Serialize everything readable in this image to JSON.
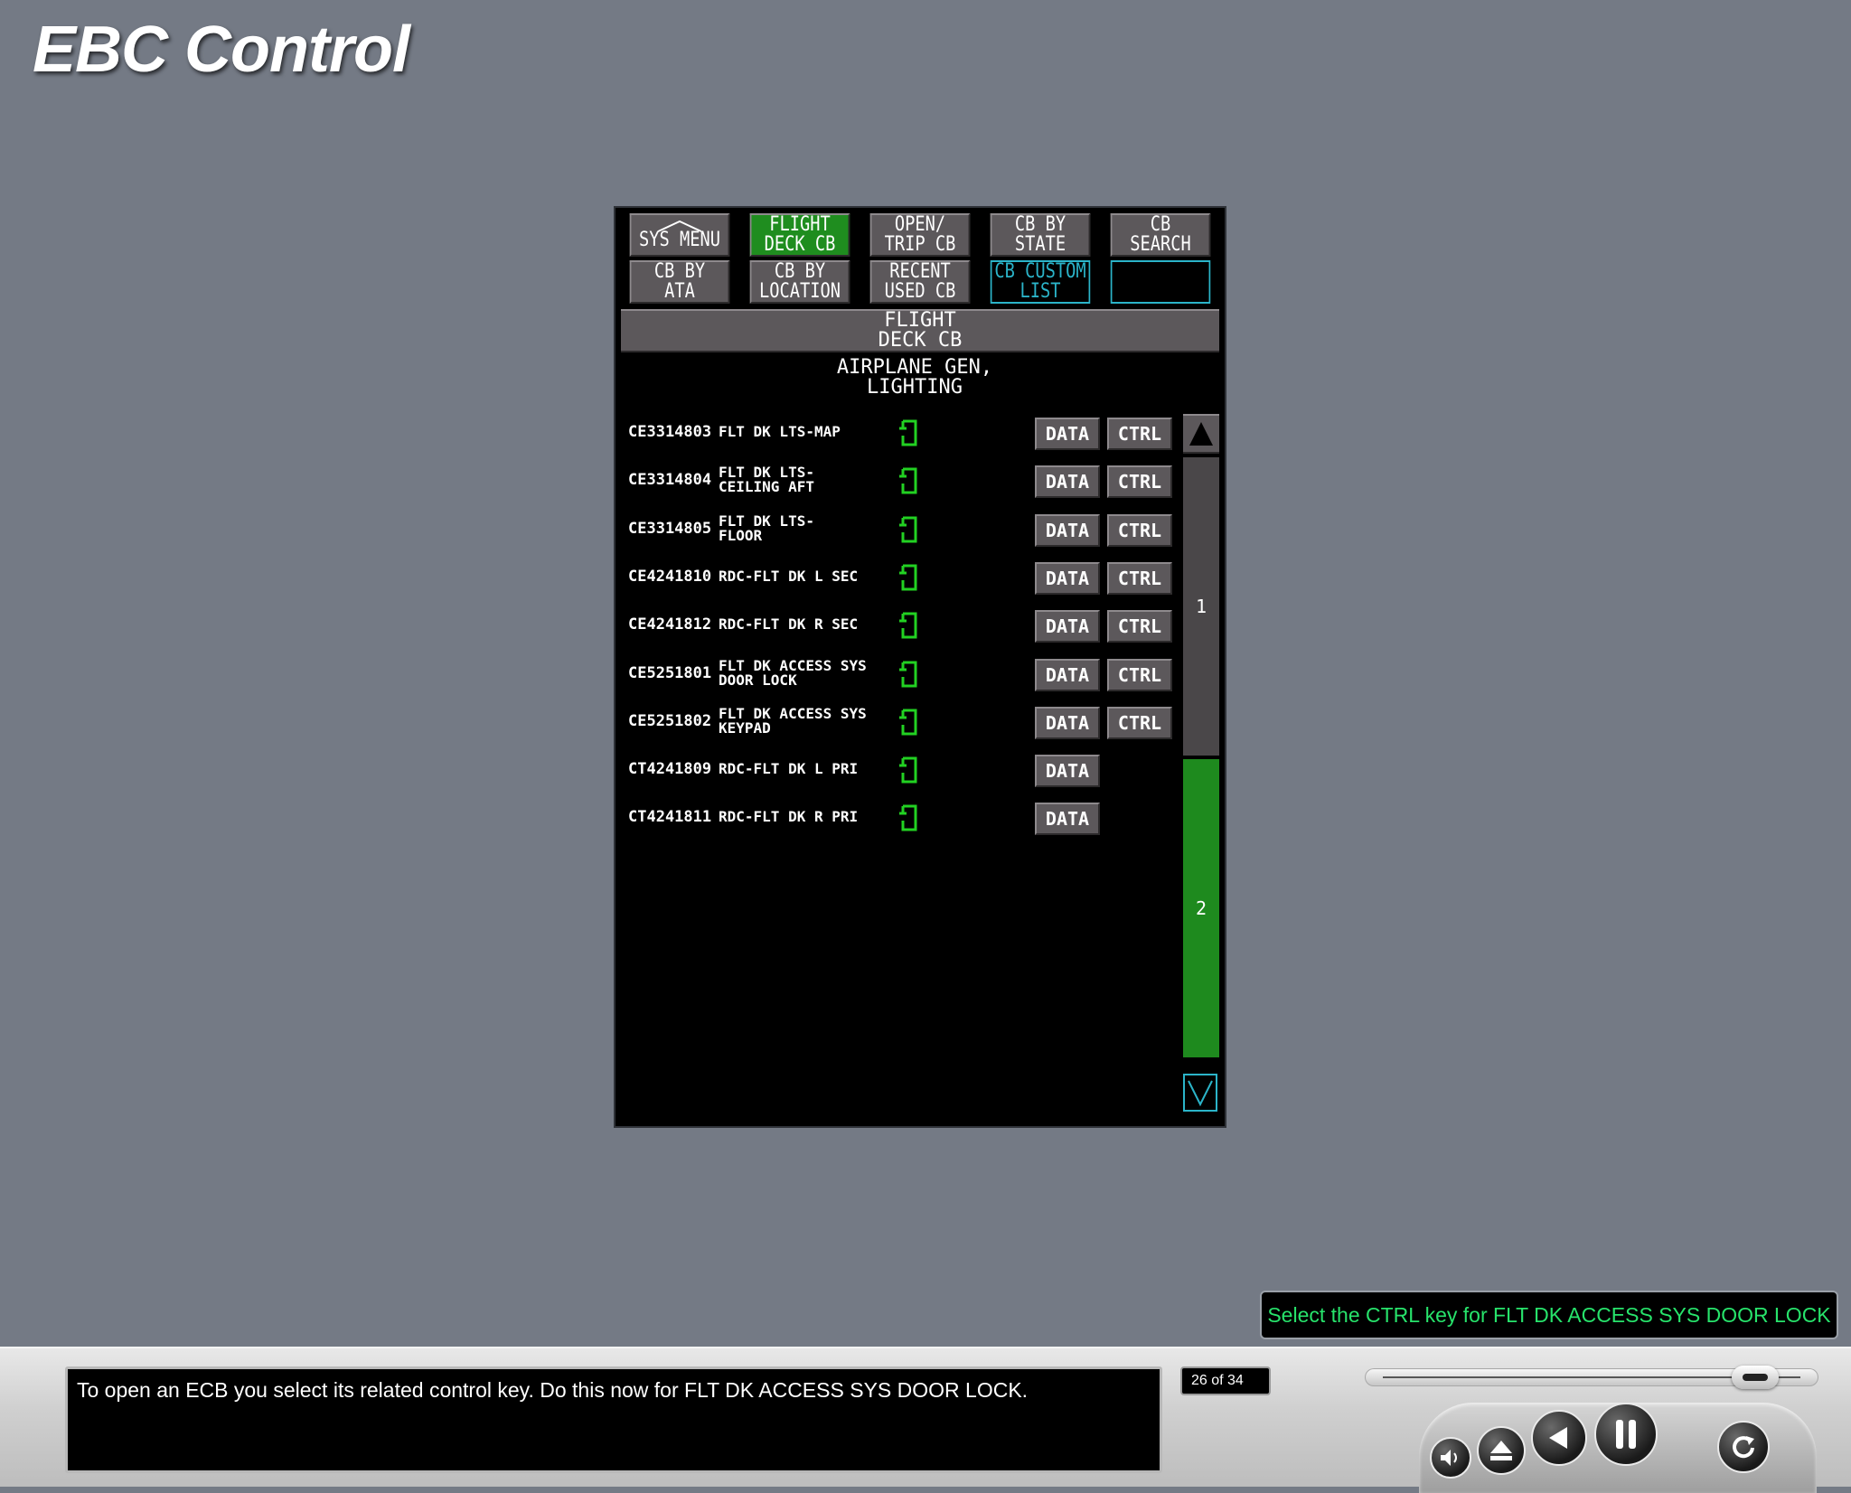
{
  "page": {
    "title": "EBC Control"
  },
  "display": {
    "menu_row1": [
      {
        "label": "SYS MENU",
        "state": "normal",
        "icon": "up-triangle-icon"
      },
      {
        "label": "FLIGHT\nDECK CB",
        "state": "active"
      },
      {
        "label": "OPEN/\nTRIP CB",
        "state": "normal"
      },
      {
        "label": "CB BY\nSTATE",
        "state": "normal"
      },
      {
        "label": "CB\nSEARCH",
        "state": "normal"
      }
    ],
    "menu_row2": [
      {
        "label": "CB BY\nATA",
        "state": "normal"
      },
      {
        "label": "CB BY\nLOCATION",
        "state": "normal"
      },
      {
        "label": "RECENT\nUSED CB",
        "state": "normal"
      },
      {
        "label": "CB CUSTOM\nLIST",
        "state": "custom"
      },
      {
        "label": "",
        "state": "blank"
      }
    ],
    "subtitle": "FLIGHT\nDECK CB",
    "category": "AIRPLANE GEN,\nLIGHTING",
    "rows": [
      {
        "id": "CE3314803",
        "name": "FLT DK LTS-MAP",
        "data_label": "DATA",
        "ctrl_label": "CTRL"
      },
      {
        "id": "CE3314804",
        "name": "FLT DK LTS-\nCEILING AFT",
        "data_label": "DATA",
        "ctrl_label": "CTRL"
      },
      {
        "id": "CE3314805",
        "name": "FLT DK LTS-\nFLOOR",
        "data_label": "DATA",
        "ctrl_label": "CTRL"
      },
      {
        "id": "CE4241810",
        "name": "RDC-FLT DK L SEC",
        "data_label": "DATA",
        "ctrl_label": "CTRL"
      },
      {
        "id": "CE4241812",
        "name": "RDC-FLT DK R SEC",
        "data_label": "DATA",
        "ctrl_label": "CTRL"
      },
      {
        "id": "CE5251801",
        "name": "FLT DK ACCESS SYS\nDOOR LOCK",
        "data_label": "DATA",
        "ctrl_label": "CTRL"
      },
      {
        "id": "CE5251802",
        "name": "FLT DK ACCESS SYS\nKEYPAD",
        "data_label": "DATA",
        "ctrl_label": "CTRL"
      },
      {
        "id": "CT4241809",
        "name": "RDC-FLT DK L PRI",
        "data_label": "DATA",
        "ctrl_label": null
      },
      {
        "id": "CT4241811",
        "name": "RDC-FLT DK R PRI",
        "data_label": "DATA",
        "ctrl_label": null
      }
    ],
    "scroll": {
      "page1": "1",
      "page2": "2",
      "active_page": 2
    },
    "colors": {
      "active_green": "#1f8d1f",
      "cb_icon_green": "#22d122",
      "cyan": "#2bb4c9"
    }
  },
  "hint": "Select the CTRL key for FLT DK ACCESS SYS DOOR LOCK",
  "player": {
    "narration": "To open an ECB you select its related control key. Do this now for FLT DK ACCESS SYS DOOR LOCK.",
    "slide_counter": "26 of 34",
    "seek_position": 0.86,
    "controls": [
      "volume-icon",
      "eject-icon",
      "rewind-icon",
      "pause-icon",
      "replay-icon"
    ]
  }
}
